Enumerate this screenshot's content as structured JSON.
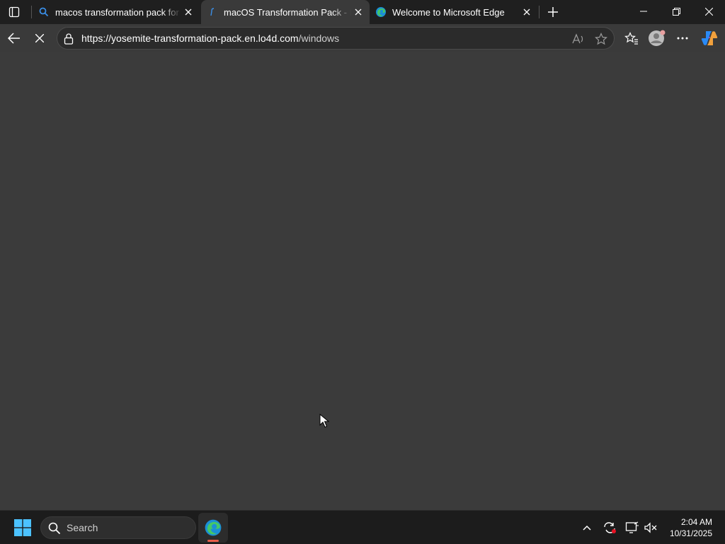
{
  "browser": {
    "tabs": [
      {
        "title": "macos transformation pack for wi",
        "favicon": "search-icon",
        "active": false
      },
      {
        "title": "macOS Transformation Pack - Dov",
        "favicon": "site-favicon",
        "active": true
      },
      {
        "title": "Welcome to Microsoft Edge",
        "favicon": "edge-icon",
        "active": false
      }
    ],
    "address_bar": {
      "url_host": "https://yosemite-transformation-pack.en.lo4d.com",
      "url_path": "/windows"
    },
    "loading": true
  },
  "taskbar": {
    "search_placeholder": "Search",
    "time": "2:04 AM",
    "date": "10/31/2025"
  },
  "colors": {
    "page_background": "#3b3b3b",
    "toolbar": "#3a3a3a",
    "tabstrip": "#1f1f1f",
    "taskbar": "#1c1c1c"
  }
}
